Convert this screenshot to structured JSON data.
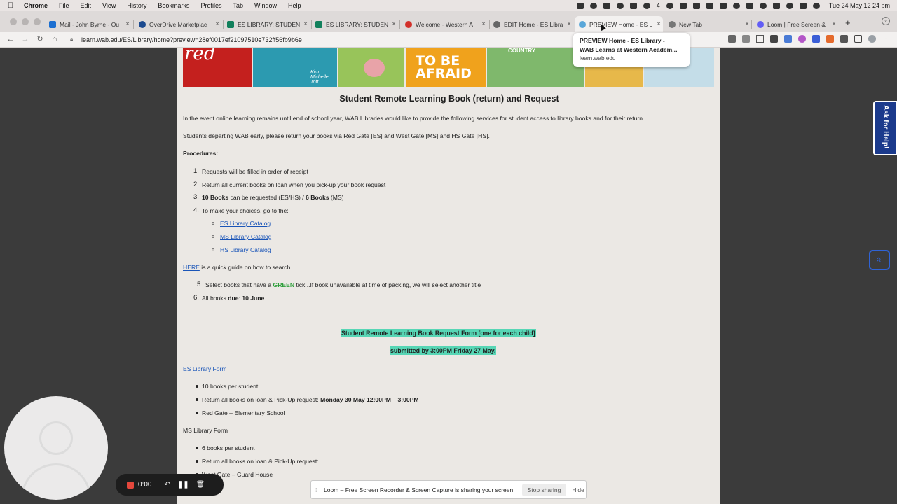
{
  "menubar": {
    "app": "Chrome",
    "items": [
      "File",
      "Edit",
      "View",
      "History",
      "Bookmarks",
      "Profiles",
      "Tab",
      "Window",
      "Help"
    ],
    "clock": "Tue 24 May  12 24 pm",
    "teams_badge": "4"
  },
  "tabs": [
    {
      "title": "Mail - John Byrne - Ou",
      "color": "#1c6fd1"
    },
    {
      "title": "OverDrive Marketplac",
      "color": "#1c4a8f"
    },
    {
      "title": "ES LIBRARY: STUDEN",
      "color": "#12805c"
    },
    {
      "title": "ES LIBRARY: STUDEN",
      "color": "#12805c"
    },
    {
      "title": "Welcome - Western A",
      "color": "#d3302a"
    },
    {
      "title": "EDIT Home - ES Libra",
      "color": "#666666"
    },
    {
      "title": "PREVIEW Home - ES L",
      "color": "#5aa7d9"
    },
    {
      "title": "New Tab",
      "color": "#777777"
    },
    {
      "title": "Loom | Free Screen &",
      "color": "#625df5"
    }
  ],
  "toolbar": {
    "url": "learn.wab.edu/ES/Library/home?preview=28ef0017ef21097510e732ff56fb9b6e"
  },
  "tooltip": {
    "title_line1": "PREVIEW Home - ES Library -",
    "title_line2": "WAB Learns at Western Academ...",
    "domain": "learn.wab.edu"
  },
  "banner": {
    "cover1": "red",
    "cover2": "Kim Michelle Toft",
    "cover4": "TO BE AFRAID",
    "cover5": "COUNTRY"
  },
  "main": {
    "heading": "Student Remote Learning Book (return) and Request",
    "intro": "In the event online learning remains until end of school year, WAB Libraries would like to provide the following services for student access to library books and for their return.",
    "departing": "Students departing WAB early, please return your books via Red Gate [ES] and West Gate [MS] and HS Gate [HS].",
    "procedures_label": "Procedures:",
    "steps": [
      {
        "num": "1.",
        "text": "Requests will be filled in order of receipt"
      },
      {
        "num": "2.",
        "text": "Return all current books on loan when you pick-up your book request"
      },
      {
        "num": "3.",
        "bold1": "10 Books",
        "mid": " can be requested (ES/HS) / ",
        "bold2": "6 Books",
        "tail": " (MS)"
      },
      {
        "num": "4.",
        "text": "To make your choices, go to the:"
      }
    ],
    "catalog_links": [
      "ES Library Catalog",
      "MS Library Catalog",
      "HS Library Catalog"
    ],
    "here_link": "HERE",
    "here_text": " is a quick guide on how to search",
    "step5": {
      "num": "5.",
      "pre": "Select books that have a ",
      "green": "GREEN",
      "post": " tick...If book unavailable at time of packing, we will select another title"
    },
    "step6": {
      "num": "6.",
      "pre": "All books ",
      "bold": "due",
      "post": ": ",
      "date": "10 June"
    },
    "form_banner1": "Student Remote Learning Book Request Form [one for each child]",
    "form_banner2": "submitted by 3:00PM Friday 27 May.",
    "es_form_link": "ES Library Form",
    "es_items": [
      "10 books per student",
      "Return all books on loan & Pick-Up request: ",
      "Red Gate – Elementary School"
    ],
    "es_pickup_bold": "Monday 30 May 12:00PM – 3:00PM",
    "ms_form_label": "MS Library Form",
    "ms_items": [
      "6 books per student",
      "Return all books on loan & Pick-Up request:",
      "West Gate – Guard House"
    ]
  },
  "widgets": {
    "ask_help": "Ask for Help!",
    "scroll_top": "«"
  },
  "recorder": {
    "time": "0:00"
  },
  "sharebar": {
    "message": "Loom – Free Screen Recorder & Screen Capture is sharing your screen.",
    "stop": "Stop sharing",
    "hide": "Hide"
  }
}
